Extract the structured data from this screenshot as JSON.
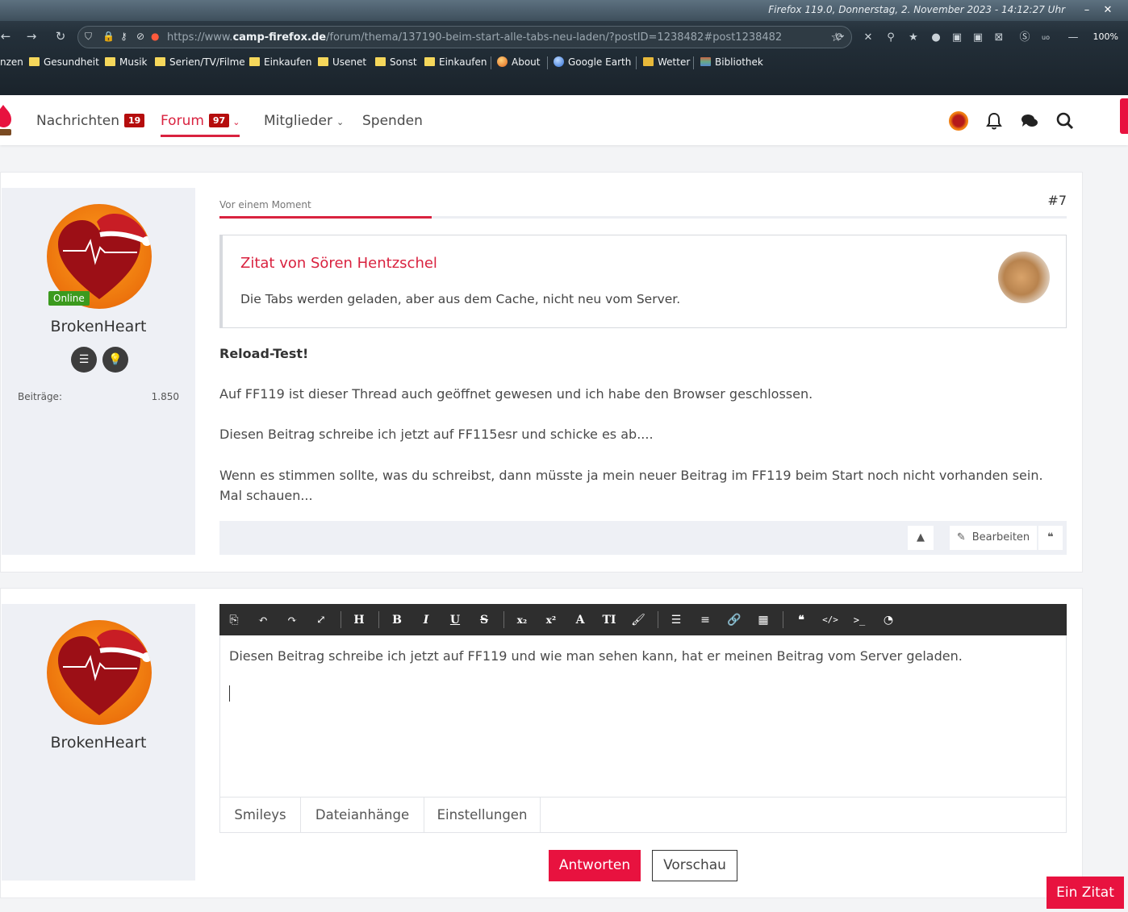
{
  "browser": {
    "title": "Firefox 119.0, Donnerstag, 2. November 2023 - 14:12:27 Uhr",
    "url_prefix": "https://www.",
    "url_domain": "camp-firefox.de",
    "url_path": "/forum/thema/137190-beim-start-alle-tabs-neu-laden/?postID=1238482#post1238482",
    "zoom": "100%",
    "bookmarks": [
      {
        "label": "nzen",
        "icon": "folder-icon"
      },
      {
        "label": "Gesundheit",
        "icon": "folder-icon"
      },
      {
        "label": "Musik",
        "icon": "folder-icon"
      },
      {
        "label": "Serien/TV/Filme",
        "icon": "folder-icon"
      },
      {
        "label": "Einkaufen",
        "icon": "folder-icon"
      },
      {
        "label": "Usenet",
        "icon": "folder-icon"
      },
      {
        "label": "Sonst",
        "icon": "folder-icon"
      },
      {
        "label": "Einkaufen",
        "icon": "folder-icon"
      },
      {
        "label": "About",
        "icon": "firefox-icon"
      },
      {
        "label": "Google Earth",
        "icon": "globe-icon"
      },
      {
        "label": "Wetter",
        "icon": "weather-icon"
      },
      {
        "label": "Bibliothek",
        "icon": "books-icon"
      }
    ]
  },
  "site_nav": {
    "items": [
      {
        "label": "Nachrichten",
        "badge": "19"
      },
      {
        "label": "Forum",
        "badge": "97",
        "active": true
      },
      {
        "label": "Mitglieder"
      },
      {
        "label": "Spenden"
      }
    ]
  },
  "post": {
    "author": "BrokenHeart",
    "online_label": "Online",
    "stats_label": "Beiträge:",
    "stats_value": "1.850",
    "time": "Vor einem Moment",
    "number": "#7",
    "quote_title": "Zitat von Sören Hentzschel",
    "quote_text": "Die Tabs werden geladen, aber aus dem Cache, nicht neu vom Server.",
    "paragraphs": [
      "Reload-Test!",
      "Auf FF119 ist dieser Thread auch geöffnet gewesen und ich habe den Browser geschlossen.",
      "Diesen Beitrag schreibe ich jetzt auf FF115esr und schicke es ab....",
      "Wenn es stimmen sollte, was du schreibst, dann müsste ja mein neuer Beitrag im FF119 beim Start noch nicht vorhanden sein. Mal schauen..."
    ],
    "edit_label": "Bearbeiten"
  },
  "reply": {
    "author": "BrokenHeart",
    "editor_text": "Diesen Beitrag schreibe ich jetzt auf FF119 und wie man sehen kann, hat er meinen Beitrag vom Server geladen.",
    "tabs": [
      "Smileys",
      "Dateianhänge",
      "Einstellungen"
    ],
    "submit_label": "Antworten",
    "preview_label": "Vorschau"
  },
  "floating_quote_label": "Ein Zitat",
  "colors": {
    "accent": "#d9223f",
    "button_red": "#e8123f",
    "badge": "#b50d0d",
    "online": "#3b9a1e"
  }
}
